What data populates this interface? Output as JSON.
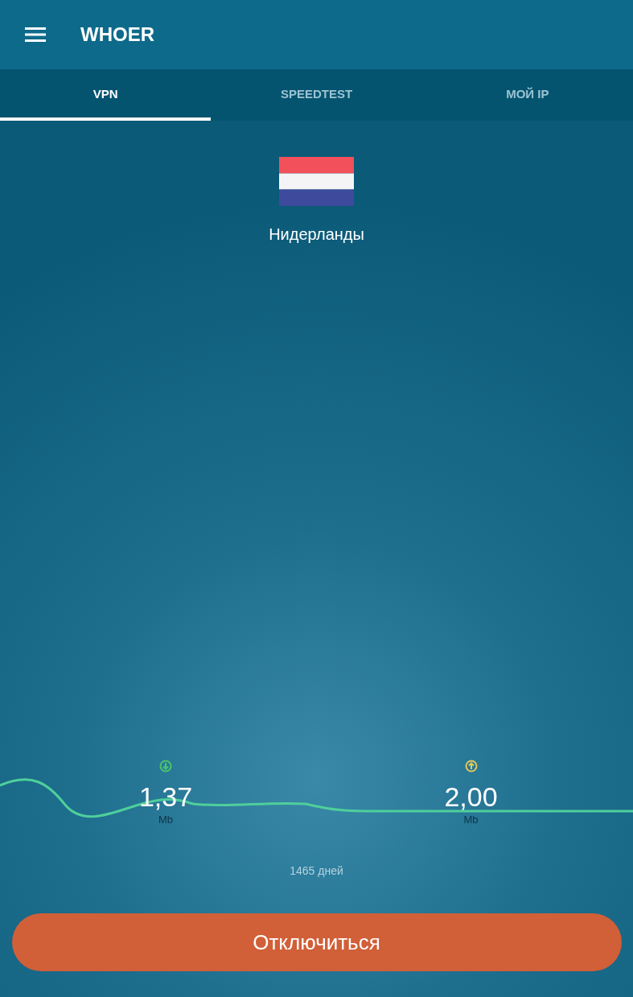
{
  "app_bar": {
    "title": "WHOER"
  },
  "tabs": [
    {
      "label": "VPN",
      "selected": true
    },
    {
      "label": "SPEEDTEST",
      "selected": false
    },
    {
      "label": "МОЙ IP",
      "selected": false
    }
  ],
  "location": {
    "country": "Нидерланды"
  },
  "traffic": [
    {
      "kind": "download",
      "value": "1,37",
      "unit": "Mb"
    },
    {
      "kind": "upload",
      "value": "2,00",
      "unit": "Mb"
    }
  ],
  "duration": "1465 дней",
  "disconnect_button": {
    "label": "Отключиться"
  }
}
